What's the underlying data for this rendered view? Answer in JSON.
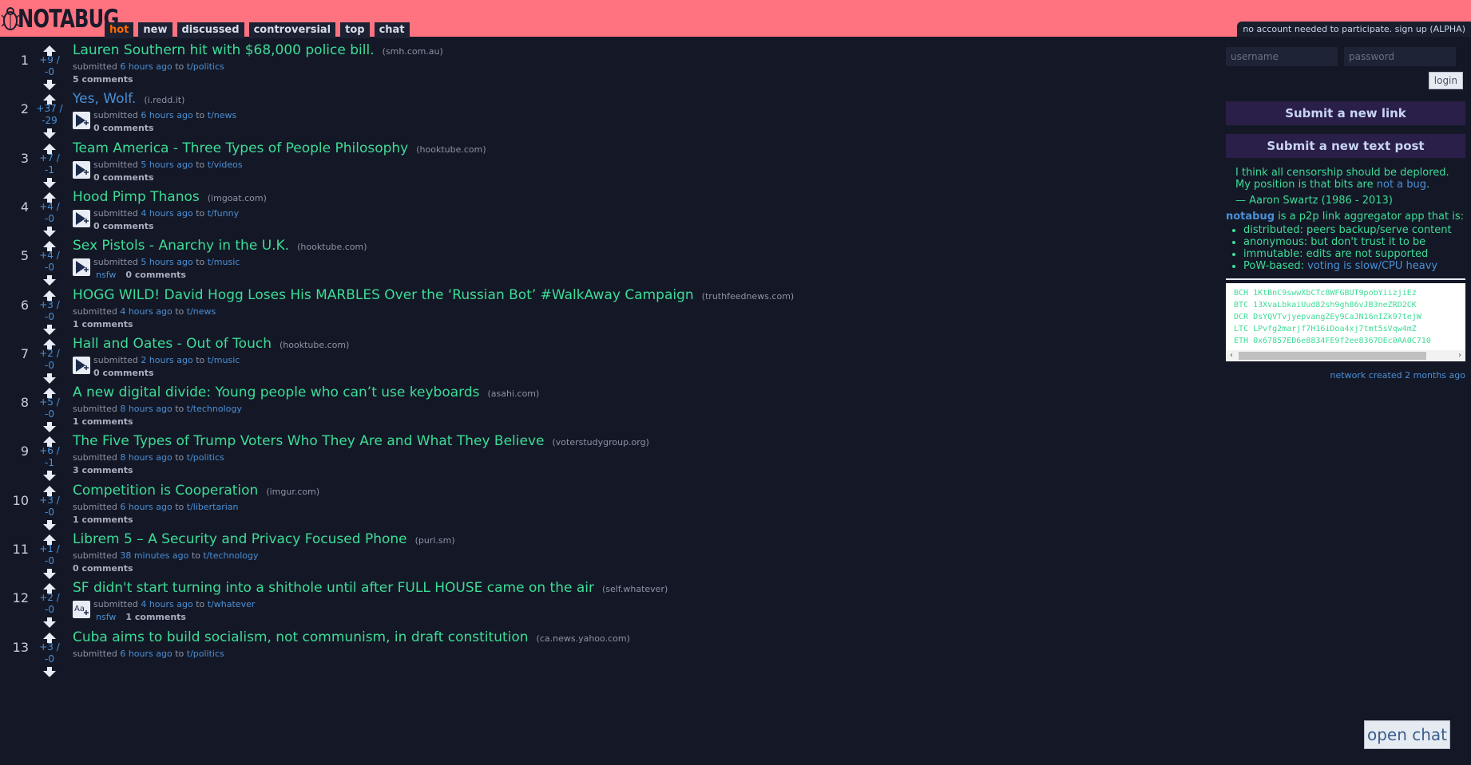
{
  "header": {
    "logo_text": "NOTABUG",
    "tabs": [
      {
        "label": "hot",
        "active": true
      },
      {
        "label": "new",
        "active": false
      },
      {
        "label": "discussed",
        "active": false
      },
      {
        "label": "controversial",
        "active": false
      },
      {
        "label": "top",
        "active": false
      },
      {
        "label": "chat",
        "active": false
      }
    ],
    "signup_text": "no account needed to participate. sign up (ALPHA)"
  },
  "posts": [
    {
      "rank": "1",
      "up": "+9 /",
      "down": "-0",
      "title": "Lauren Southern hit with $68,000 police bill.",
      "domain": "(smh.com.au)",
      "submitted": "submitted",
      "ago": "6 hours ago",
      "to": "to",
      "topic": "t/politics",
      "comments": "5 comments",
      "thumb": false,
      "nsfw": false,
      "title_color": "green"
    },
    {
      "rank": "2",
      "up": "+37 /",
      "down": "-29",
      "title": "Yes, Wolf.",
      "domain": "(i.redd.it)",
      "submitted": "submitted",
      "ago": "6 hours ago",
      "to": "to",
      "topic": "t/news",
      "comments": "0 comments",
      "thumb": "play",
      "nsfw": false,
      "title_color": "blue"
    },
    {
      "rank": "3",
      "up": "+7 /",
      "down": "-1",
      "title": "Team America - Three Types of People Philosophy",
      "domain": "(hooktube.com)",
      "submitted": "submitted",
      "ago": "5 hours ago",
      "to": "to",
      "topic": "t/videos",
      "comments": "0 comments",
      "thumb": "play",
      "nsfw": false,
      "title_color": "green"
    },
    {
      "rank": "4",
      "up": "+4 /",
      "down": "-0",
      "title": "Hood Pimp Thanos",
      "domain": "(imgoat.com)",
      "submitted": "submitted",
      "ago": "4 hours ago",
      "to": "to",
      "topic": "t/funny",
      "comments": "0 comments",
      "thumb": "play",
      "nsfw": false,
      "title_color": "green"
    },
    {
      "rank": "5",
      "up": "+4 /",
      "down": "-0",
      "title": "Sex Pistols - Anarchy in the U.K.",
      "domain": "(hooktube.com)",
      "submitted": "submitted",
      "ago": "5 hours ago",
      "to": "to",
      "topic": "t/music",
      "comments": "0 comments",
      "thumb": "play",
      "nsfw": true,
      "title_color": "green"
    },
    {
      "rank": "6",
      "up": "+3 /",
      "down": "-0",
      "title": "HOGG WILD! David Hogg Loses His MARBLES Over the ‘Russian Bot’ #WalkAway Campaign",
      "domain": "(truthfeednews.com)",
      "submitted": "submitted",
      "ago": "4 hours ago",
      "to": "to",
      "topic": "t/news",
      "comments": "1 comments",
      "thumb": false,
      "nsfw": false,
      "title_color": "green"
    },
    {
      "rank": "7",
      "up": "+2 /",
      "down": "-0",
      "title": "Hall and Oates - Out of Touch",
      "domain": "(hooktube.com)",
      "submitted": "submitted",
      "ago": "2 hours ago",
      "to": "to",
      "topic": "t/music",
      "comments": "0 comments",
      "thumb": "play",
      "nsfw": false,
      "title_color": "green"
    },
    {
      "rank": "8",
      "up": "+5 /",
      "down": "-0",
      "title": "A new digital divide: Young people who can’t use keyboards",
      "domain": "(asahi.com)",
      "submitted": "submitted",
      "ago": "8 hours ago",
      "to": "to",
      "topic": "t/technology",
      "comments": "1 comments",
      "thumb": false,
      "nsfw": false,
      "title_color": "green"
    },
    {
      "rank": "9",
      "up": "+6 /",
      "down": "-1",
      "title": "The Five Types of Trump Voters Who They Are and What They Believe",
      "domain": "(voterstudygroup.org)",
      "submitted": "submitted",
      "ago": "8 hours ago",
      "to": "to",
      "topic": "t/politics",
      "comments": "3 comments",
      "thumb": false,
      "nsfw": false,
      "title_color": "green"
    },
    {
      "rank": "10",
      "up": "+3 /",
      "down": "-0",
      "title": "Competition is Cooperation",
      "domain": "(imgur.com)",
      "submitted": "submitted",
      "ago": "6 hours ago",
      "to": "to",
      "topic": "t/libertarian",
      "comments": "1 comments",
      "thumb": false,
      "nsfw": false,
      "title_color": "green"
    },
    {
      "rank": "11",
      "up": "+1 /",
      "down": "-0",
      "title": "Librem 5 – A Security and Privacy Focused Phone",
      "domain": "(puri.sm)",
      "submitted": "submitted",
      "ago": "38 minutes ago",
      "to": "to",
      "topic": "t/technology",
      "comments": "0 comments",
      "thumb": false,
      "nsfw": false,
      "title_color": "green"
    },
    {
      "rank": "12",
      "up": "+2 /",
      "down": "-0",
      "title": "SF didn't start turning into a shithole until after FULL HOUSE came on the air",
      "domain": "(self.whatever)",
      "submitted": "submitted",
      "ago": "4 hours ago",
      "to": "to",
      "topic": "t/whatever",
      "comments": "1 comments",
      "thumb": "text",
      "nsfw": true,
      "title_color": "green"
    },
    {
      "rank": "13",
      "up": "+3 /",
      "down": "-0",
      "title": "Cuba aims to build socialism, not communism, in draft constitution",
      "domain": "(ca.news.yahoo.com)",
      "submitted": "submitted",
      "ago": "6 hours ago",
      "to": "to",
      "topic": "t/politics",
      "comments": "",
      "thumb": false,
      "nsfw": false,
      "title_color": "green"
    }
  ],
  "nsfw_label": "nsfw",
  "sidebar": {
    "username_placeholder": "username",
    "password_placeholder": "password",
    "login_label": "login",
    "submit_link": "Submit a new link",
    "submit_text": "Submit a new text post",
    "quote_line1": "I think all censorship should be deplored.",
    "quote_line2a": "My position is that bits are",
    "quote_line2b": "not a bug",
    "quote_line2c": ".",
    "quote_author": "— Aaron Swartz (1986 - 2013)",
    "about_brand": "notabug",
    "about_text": "is a p2p link aggregator app that is:",
    "features": [
      {
        "a": "distributed: peers backup/serve content",
        "b": ""
      },
      {
        "a": "anonymous: but don't trust it to be",
        "b": ""
      },
      {
        "a": "immutable: edits are not supported",
        "b": ""
      },
      {
        "a": "PoW-based:",
        "b": "voting is slow/CPU heavy"
      }
    ],
    "crypto": [
      "BCH 1KtBnC9swwXbCTc8WFGBUT9pobYiizjiEz",
      "BTC 13XvaLbkaiUud82sh9gh86vJB3neZRD2CK",
      "DCR DsYQVTvjyepvangZEy9CaJN16nIZk97tejW",
      "LTC LPvfg2marjf7H16iDoa4xj7tmt5sVqw4mZ",
      "ETH 0x67857ED6e8834FE9f2ee8367DEc0AA0C710"
    ],
    "network_text": "network created",
    "network_ago": "2 months ago"
  },
  "open_chat_label": "open chat",
  "colors": {
    "header": "#ff7380",
    "background": "#141826",
    "title_green": "#3ddc97",
    "link_blue": "#4a8fd6",
    "active_tab": "#ff6a00"
  }
}
